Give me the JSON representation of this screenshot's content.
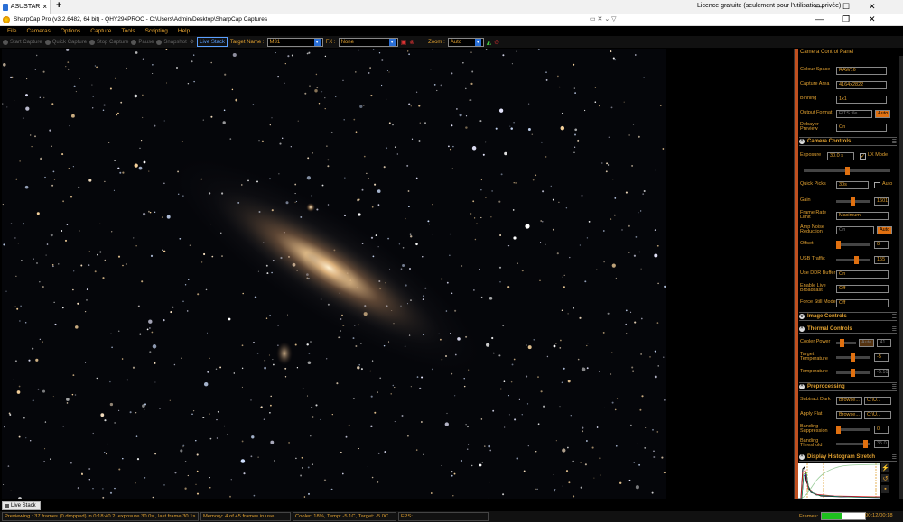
{
  "remote_tab": {
    "label": "ASUSTAR",
    "close": "×",
    "new_tab": "+"
  },
  "licence": "Licence gratuite (seulement pour l'utilisation privée)",
  "window_controls": {
    "minimize": "—",
    "maximize": "☐",
    "restore": "❐",
    "close": "✕"
  },
  "app": {
    "title": "SharpCap Pro (v3.2.6482, 64 bit) - QHY294PROC - C:\\Users\\Admin\\Desktop\\SharpCap Captures"
  },
  "menu": [
    "File",
    "Cameras",
    "Options",
    "Capture",
    "Tools",
    "Scripting",
    "Help"
  ],
  "toolbar": {
    "start_capture": "Start Capture",
    "quick_capture": "Quick Capture",
    "stop_capture": "Stop Capture",
    "pause": "Pause",
    "snapshot": "Snapshot",
    "live_stack": "Live Stack",
    "target_name_label": "Target Name :",
    "target_name_value": "M31",
    "fx_label": "FX :",
    "fx_value": "None",
    "zoom_label": "Zoom :",
    "zoom_value": "Auto"
  },
  "panel": {
    "title": "Camera Control Panel",
    "capture_rows": [
      {
        "label": "Colour Space",
        "value": "RAW16"
      },
      {
        "label": "Capture Area",
        "value": "4164x2822"
      },
      {
        "label": "Binning",
        "value": "1x1"
      },
      {
        "label": "Output Format",
        "value": "FITS file..."
      },
      {
        "label": "Debayer Preview",
        "value": "On"
      }
    ],
    "output_auto": "Auto",
    "camera_controls": {
      "title": "Camera Controls",
      "exposure_label": "Exposure",
      "exposure_value": "30.0 s",
      "lx_mode": "LX Mode",
      "quick_picks_label": "Quick Picks",
      "quick_picks_value": "30s",
      "quick_picks_auto": "Auto",
      "gain_label": "Gain",
      "gain_value": "1601",
      "frame_rate_label": "Frame Rate Limit",
      "frame_rate_value": "Maximum",
      "amp_noise_label": "Amp Noise Reduction",
      "amp_noise_value": "On",
      "amp_noise_auto": "Auto",
      "offset_label": "Offset",
      "offset_value": "0",
      "usb_label": "USB Traffic",
      "usb_value": "155",
      "ddr_label": "Use DDR Buffer",
      "ddr_value": "On",
      "live_broadcast_label": "Enable Live Broadcast",
      "live_broadcast_value": "Off",
      "force_still_label": "Force Still Mode",
      "force_still_value": "Off"
    },
    "image_controls": {
      "title": "Image Controls"
    },
    "thermal": {
      "title": "Thermal Controls",
      "cooler_label": "Cooler Power",
      "cooler_auto": "Auto",
      "cooler_value": "41",
      "target_label": "Target Temperature",
      "target_value": "-5",
      "temp_label": "Temperature",
      "temp_value": "-5.10"
    },
    "preprocessing": {
      "title": "Preprocessing",
      "dark_label": "Subtract Dark",
      "dark_browse": "Browse...",
      "dark_value": "C:\\U...",
      "flat_label": "Apply Flat",
      "flat_browse": "Browse...",
      "flat_value": "C:\\U...",
      "banding_supp_label": "Banding Suppression",
      "banding_supp_value": "0",
      "banding_thr_label": "Banding Threshold",
      "banding_thr_value": "35.0"
    },
    "histogram": {
      "title": "Display Histogram Stretch"
    }
  },
  "dock_tab": "Live Stack",
  "status": {
    "preview": "Previewing : 37 frames (0 dropped) in 0:18:40.2, exposure 30.0s , last frame 30.1s",
    "memory": "Memory: 4 of 45 frames in use.",
    "cooler": "Cooler: 18%, Temp: -5.1C, Target: -5.0C",
    "fps": "FPS:",
    "frames_label": "Frames:",
    "frames_progress": 0.45,
    "time": "00:12/00:18"
  }
}
